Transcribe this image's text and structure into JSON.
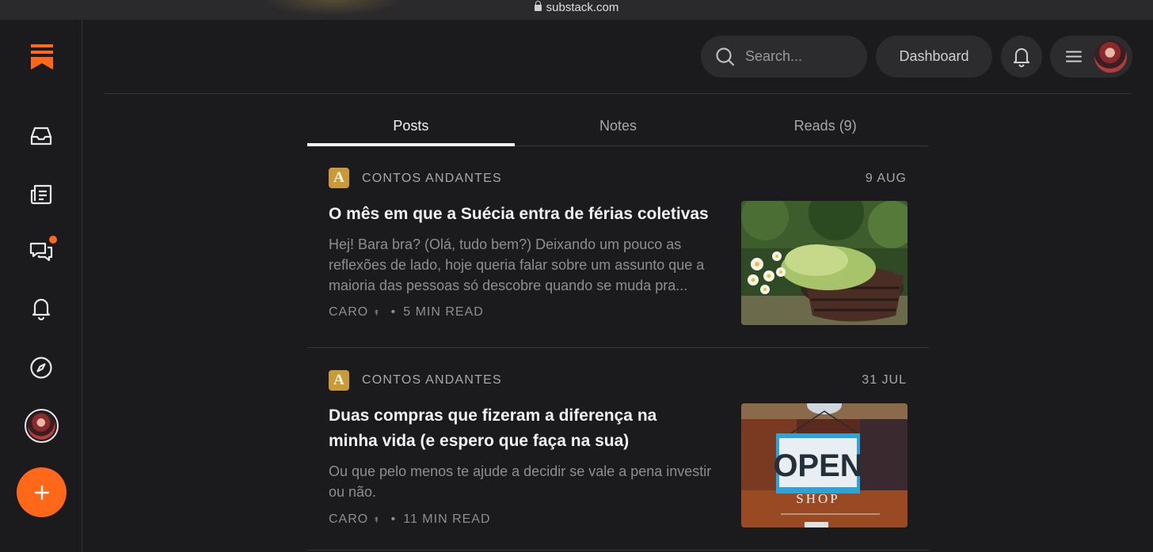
{
  "browser": {
    "url": "substack.com"
  },
  "sidebar": {
    "items": [
      {
        "name": "inbox",
        "icon": "inbox-icon"
      },
      {
        "name": "reader",
        "icon": "document-icon"
      },
      {
        "name": "chat",
        "icon": "chat-icon",
        "badge": true
      },
      {
        "name": "activity",
        "icon": "bell-icon"
      },
      {
        "name": "explore",
        "icon": "compass-icon"
      },
      {
        "name": "profile",
        "icon": "avatar"
      }
    ],
    "fab_icon": "plus-icon"
  },
  "header": {
    "search_placeholder": "Search...",
    "dashboard_label": "Dashboard"
  },
  "tabs": [
    {
      "label": "Posts",
      "active": true
    },
    {
      "label": "Notes",
      "active": false
    },
    {
      "label": "Reads (9)",
      "active": false
    }
  ],
  "posts": [
    {
      "publication_initial": "A",
      "publication": "CONTOS ANDANTES",
      "date": "9 AUG",
      "title": "O mês em que a Suécia entra de férias coletivas",
      "excerpt": "Hej! Bara bra? (Olá, tudo bem?) Deixando um pouco as reflexões de lado, hoje queria falar sobre um assunto que a maioria das pessoas só descobre quando se muda pra...",
      "author": "CARO",
      "author_marker": "↟",
      "read_time": "5 MIN READ"
    },
    {
      "publication_initial": "A",
      "publication": "CONTOS ANDANTES",
      "date": "31 JUL",
      "title": "Duas compras que fizeram a diferença na minha vida (e espero que faça na sua)",
      "excerpt": "Ou que pelo menos te ajude a decidir se vale a pena investir ou não.",
      "author": "CARO",
      "author_marker": "↟",
      "read_time": "11 MIN READ",
      "thumb_sign": "OPEN",
      "thumb_sign_sub": "SHOP"
    }
  ],
  "colors": {
    "accent": "#ff6719",
    "background": "#1b1b1d",
    "publication": "#c89a3a"
  }
}
